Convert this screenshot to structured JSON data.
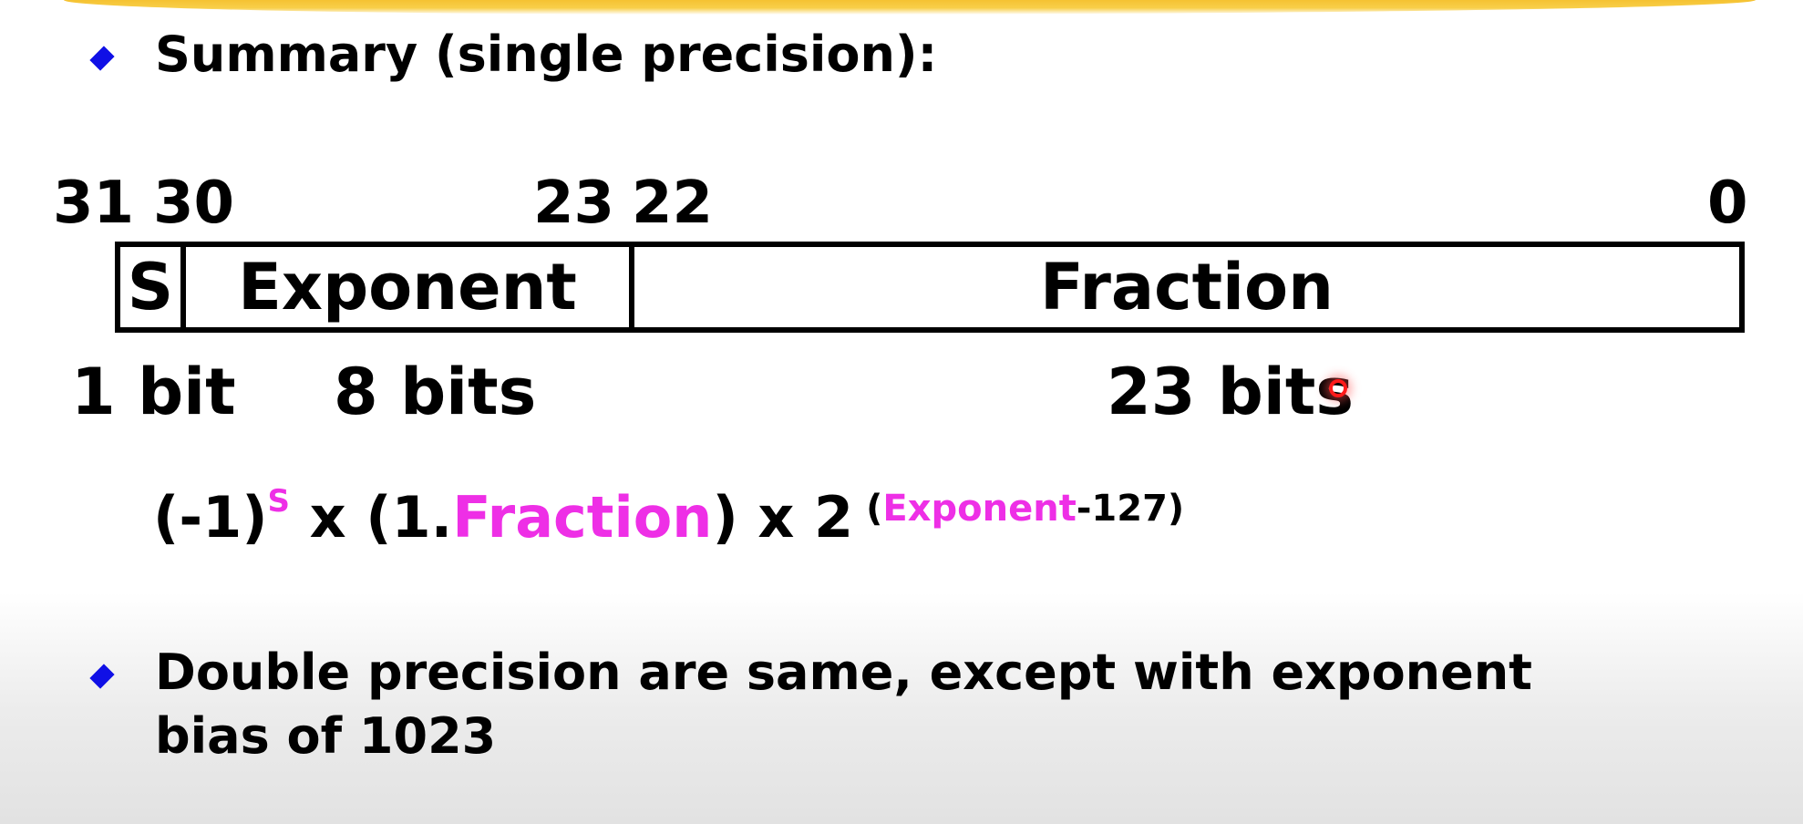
{
  "summary": {
    "title": "Summary (single precision):"
  },
  "layout_diagram": {
    "bit_numbers": {
      "b31": "31",
      "b30": "30",
      "b23": "23",
      "b22": "22",
      "b0": "0"
    },
    "fields": {
      "sign": "S",
      "exponent": "Exponent",
      "fraction": "Fraction"
    },
    "sizes": {
      "sign": "1 bit",
      "exponent": "8 bits",
      "fraction": "23 bits"
    }
  },
  "formula": {
    "base": "(-1)",
    "sign_sup": "S",
    "mult1": " x (1.",
    "fraction": "Fraction",
    "close_paren": ")",
    "mult2": " x 2",
    "exp_open": "(",
    "exp_word": "Exponent",
    "exp_rest": "-127)"
  },
  "double": {
    "line1": "Double precision are same, except with exponent",
    "line2": "bias of 1023"
  },
  "colors": {
    "bullet": "#1010e6",
    "highlight": "#ee2fe6",
    "title_bar": "#f5c232"
  }
}
